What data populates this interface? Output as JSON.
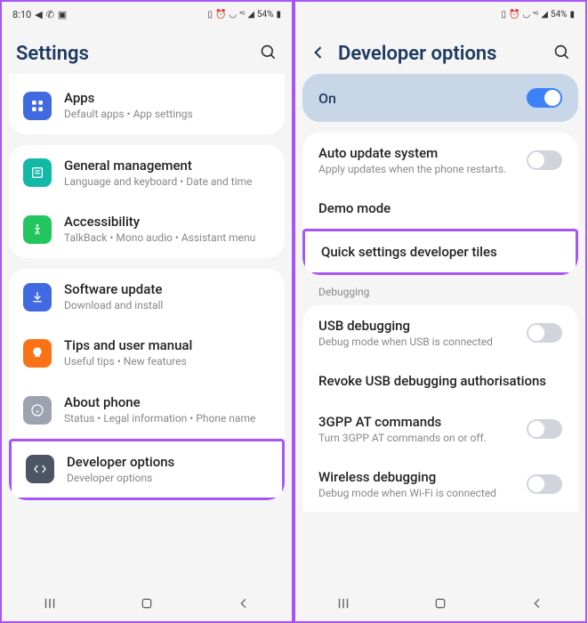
{
  "status": {
    "time": "8:10",
    "battery": "54%"
  },
  "left": {
    "title": "Settings",
    "items": {
      "apps": {
        "title": "Apps",
        "sub": "Default apps  •  App settings"
      },
      "general": {
        "title": "General management",
        "sub": "Language and keyboard  •  Date and time"
      },
      "accessibility": {
        "title": "Accessibility",
        "sub": "TalkBack  •  Mono audio  •  Assistant menu"
      },
      "software": {
        "title": "Software update",
        "sub": "Download and install"
      },
      "tips": {
        "title": "Tips and user manual",
        "sub": "Useful tips  •  New features"
      },
      "about": {
        "title": "About phone",
        "sub": "Status  •  Legal information  •  Phone name"
      },
      "dev": {
        "title": "Developer options",
        "sub": "Developer options"
      }
    }
  },
  "right": {
    "title": "Developer options",
    "on_label": "On",
    "items": {
      "auto_update": {
        "title": "Auto update system",
        "sub": "Apply updates when the phone restarts."
      },
      "demo": {
        "title": "Demo mode"
      },
      "quick": {
        "title": "Quick settings developer tiles"
      },
      "section": "Debugging",
      "usb": {
        "title": "USB debugging",
        "sub": "Debug mode when USB is connected"
      },
      "revoke": {
        "title": "Revoke USB debugging authorisations"
      },
      "gpp": {
        "title": "3GPP AT commands",
        "sub": "Turn 3GPP AT commands on or off."
      },
      "wireless": {
        "title": "Wireless debugging",
        "sub": "Debug mode when Wi-Fi is connected"
      }
    }
  }
}
